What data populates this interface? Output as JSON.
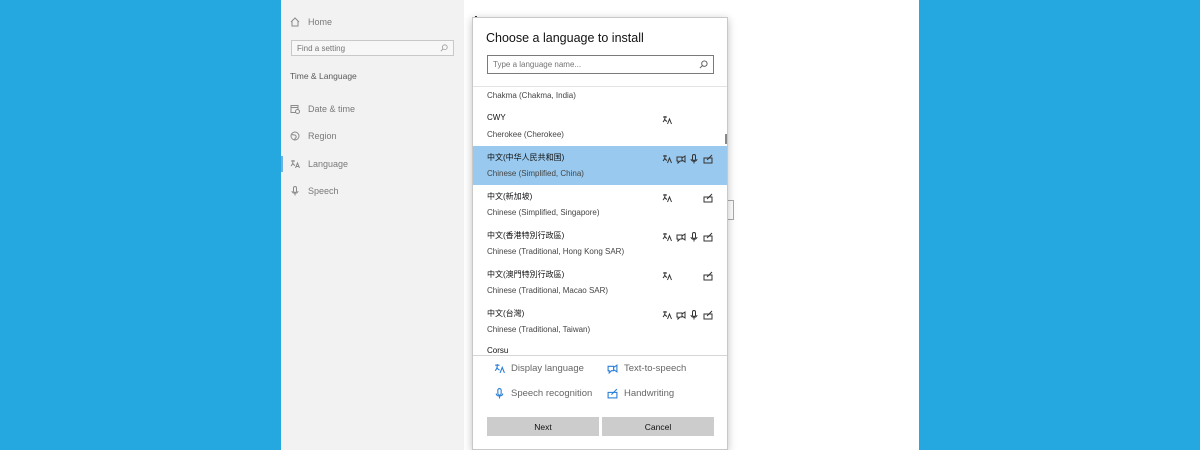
{
  "sidebar": {
    "home_label": "Home",
    "search_placeholder": "Find a setting",
    "section_title": "Time & Language",
    "items": [
      {
        "label": "Date & time"
      },
      {
        "label": "Region"
      },
      {
        "label": "Language"
      },
      {
        "label": "Speech"
      }
    ]
  },
  "dialog": {
    "title": "Choose a language to install",
    "search_placeholder": "Type a language name...",
    "partial_top": "Chakma (Chakma, India)",
    "partial_bottom": "Corsu",
    "languages": [
      {
        "native": "CWY",
        "english": "Cherokee (Cherokee)",
        "features": [
          "display-language"
        ]
      },
      {
        "native": "中文(中华人民共和国)",
        "english": "Chinese (Simplified, China)",
        "features": [
          "display-language",
          "text-to-speech",
          "speech-recognition",
          "handwriting"
        ],
        "selected": true
      },
      {
        "native": "中文(新加坡)",
        "english": "Chinese (Simplified, Singapore)",
        "features": [
          "display-language",
          "handwriting"
        ]
      },
      {
        "native": "中文(香港特別行政區)",
        "english": "Chinese (Traditional, Hong Kong SAR)",
        "features": [
          "display-language",
          "text-to-speech",
          "speech-recognition",
          "handwriting"
        ]
      },
      {
        "native": "中文(澳門特別行政區)",
        "english": "Chinese (Traditional, Macao SAR)",
        "features": [
          "display-language",
          "handwriting"
        ]
      },
      {
        "native": "中文(台灣)",
        "english": "Chinese (Traditional, Taiwan)",
        "features": [
          "display-language",
          "text-to-speech",
          "speech-recognition",
          "handwriting"
        ]
      }
    ],
    "legend": {
      "display_language": "Display language",
      "text_to_speech": "Text-to-speech",
      "speech_recognition": "Speech recognition",
      "handwriting": "Handwriting"
    },
    "next_label": "Next",
    "cancel_label": "Cancel"
  },
  "colors": {
    "background": "#25a7df",
    "selected_row": "#99c9ee",
    "legend_icon": "#2b7fd6",
    "button": "#cccccc"
  }
}
